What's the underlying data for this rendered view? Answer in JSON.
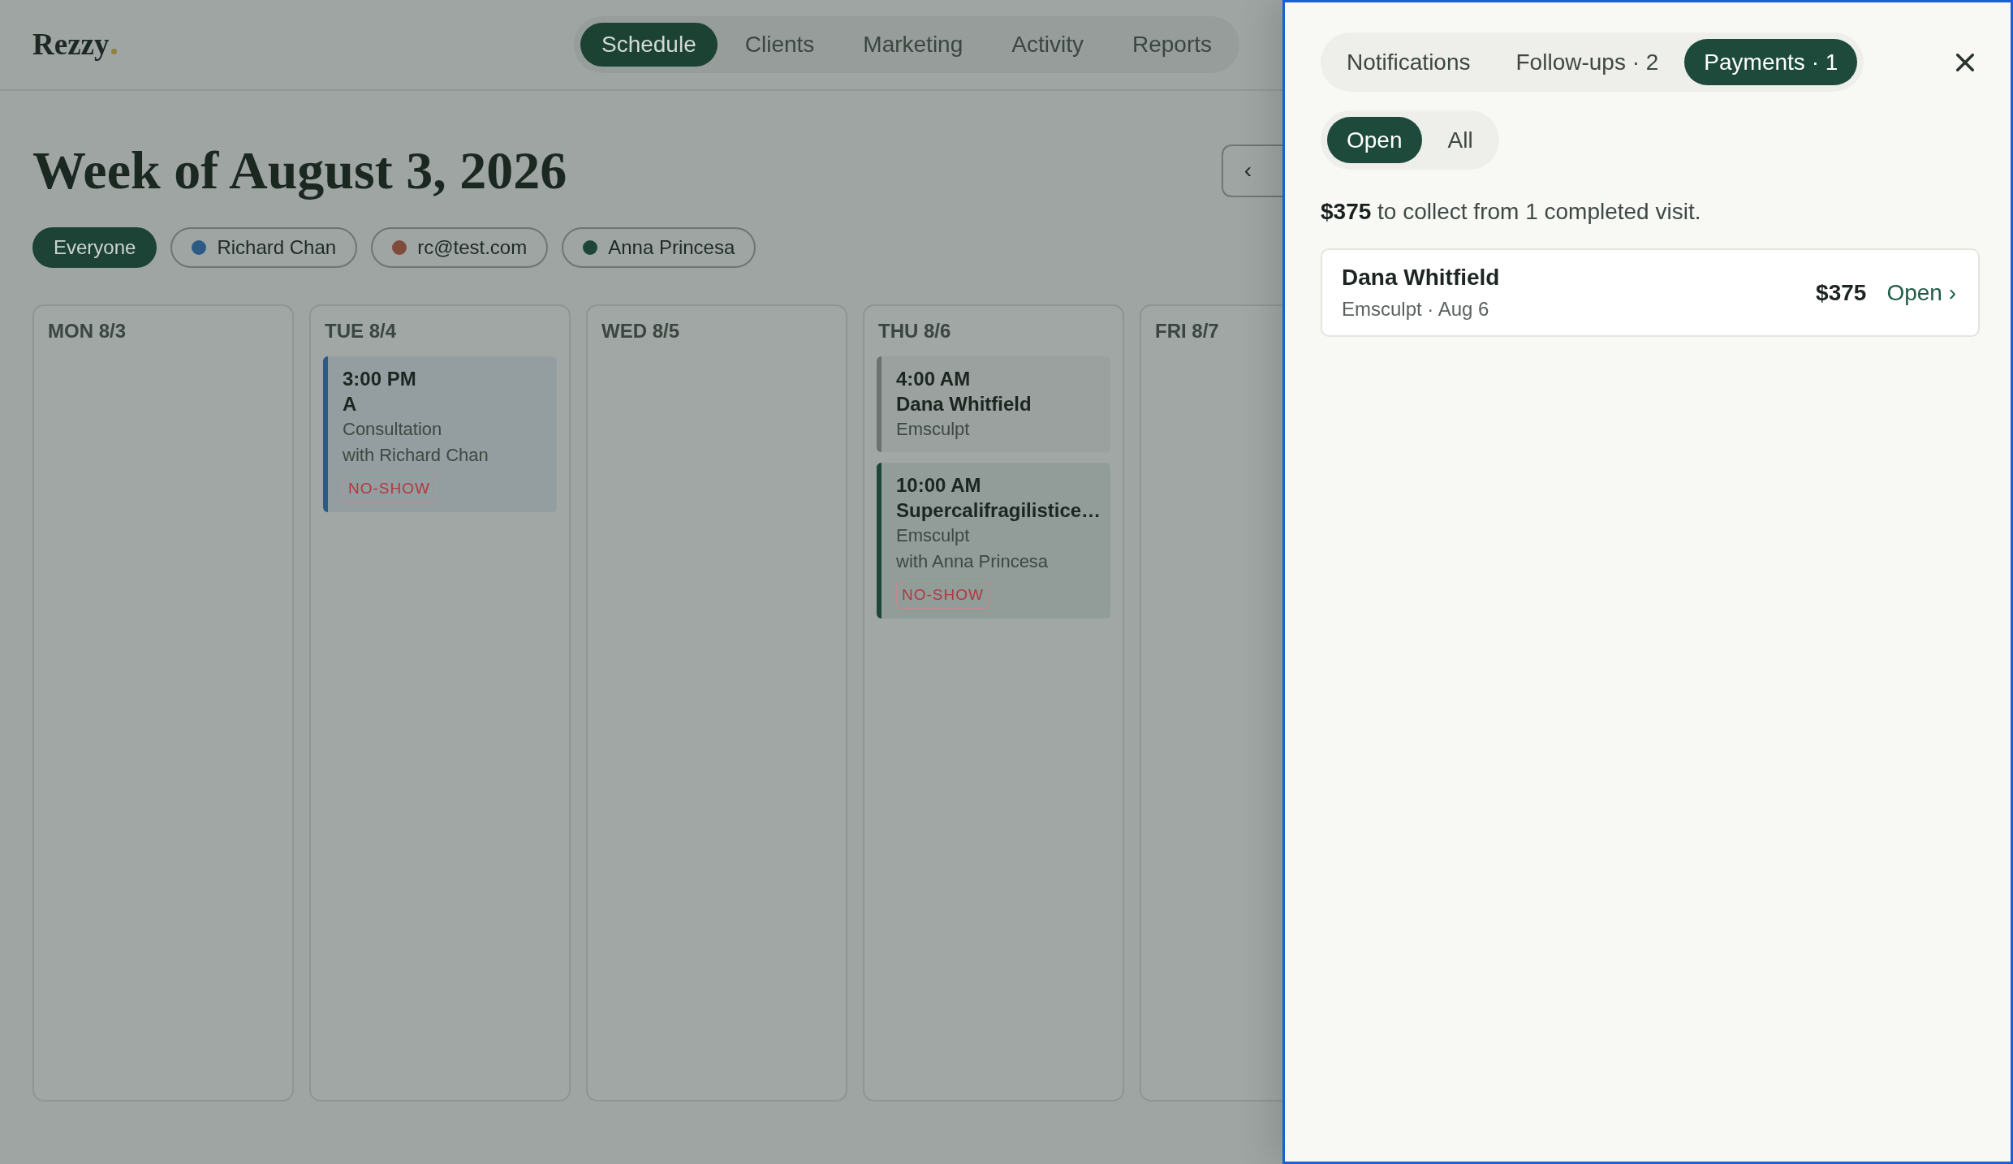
{
  "header": {
    "logo": "Rezzy",
    "nav": [
      {
        "label": "Schedule",
        "selected": true
      },
      {
        "label": "Clients",
        "selected": false
      },
      {
        "label": "Marketing",
        "selected": false
      },
      {
        "label": "Activity",
        "selected": false
      },
      {
        "label": "Reports",
        "selected": false
      }
    ]
  },
  "week": {
    "title": "Week of August 3, 2026",
    "prev_button": "‹",
    "filters": [
      {
        "label": "Everyone",
        "selected": true
      },
      {
        "label": "Richard Chan",
        "selected": false,
        "color": "#2c5a85"
      },
      {
        "label": "rc@test.com",
        "selected": false,
        "color": "#7e4b3b"
      },
      {
        "label": "Anna Princesa",
        "selected": false,
        "color": "#1e4537"
      }
    ],
    "days": [
      {
        "label": "MON 8/3"
      },
      {
        "label": "TUE 8/4",
        "events": [
          {
            "time": "3:00 PM",
            "client": "A",
            "service": "Consultation",
            "staff": "with Richard Chan",
            "status": "NO-SHOW",
            "color": "#2c5a85"
          }
        ]
      },
      {
        "label": "WED 8/5"
      },
      {
        "label": "THU 8/6",
        "events": [
          {
            "time": "4:00 AM",
            "client": "Dana Whitfield",
            "service": "Emsculpt",
            "color": "#6b726e"
          },
          {
            "time": "10:00 AM",
            "client": "Supercalifragilistice…",
            "service": "Emsculpt",
            "staff": "with Anna Princesa",
            "status": "NO-SHOW",
            "color": "#1e4537"
          }
        ]
      },
      {
        "label": "FRI 8/7"
      }
    ]
  },
  "panel": {
    "tabs": [
      {
        "label": "Notifications",
        "selected": false
      },
      {
        "label": "Follow-ups · 2",
        "selected": false
      },
      {
        "label": "Payments · 1",
        "selected": true
      }
    ],
    "segments": [
      {
        "label": "Open",
        "selected": true
      },
      {
        "label": "All",
        "selected": false
      }
    ],
    "summary": "**$375** to collect from 1 completed visit.",
    "payments": [
      {
        "client": "Dana Whitfield",
        "detail": "Emsculpt · Aug 6",
        "amount": "$375",
        "action": "Open ›"
      }
    ]
  }
}
